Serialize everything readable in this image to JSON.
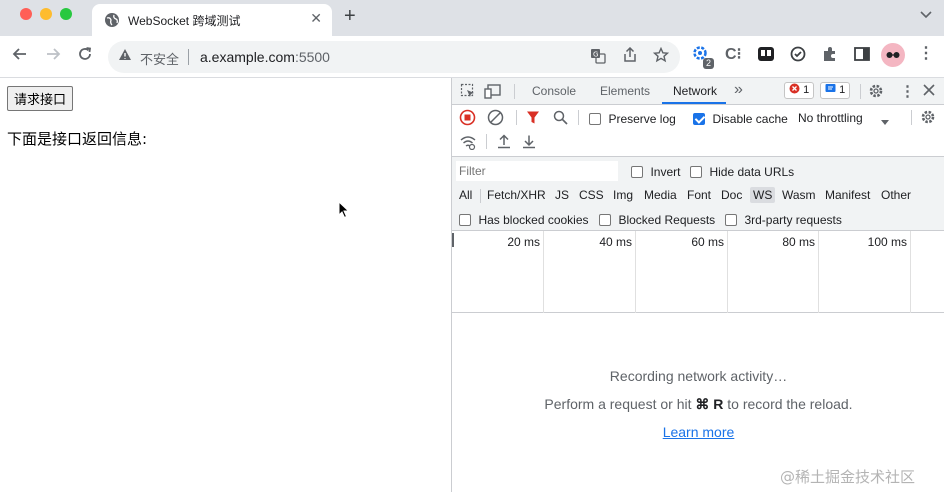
{
  "browser": {
    "tab_title": "WebSocket 跨域测试",
    "url_security": "不安全",
    "url_host": "a.example.com",
    "url_port": ":5500",
    "new_tab_glyph": "+",
    "close_glyph": "✕"
  },
  "page": {
    "request_button": "请求接口",
    "response_label": "下面是接口返回信息:"
  },
  "devtools": {
    "tabs": [
      "Console",
      "Elements",
      "Network"
    ],
    "active_tab": "Network",
    "more_tabs": "»",
    "errors_count": "1",
    "messages_count": "1",
    "preserve_log": "Preserve log",
    "disable_cache": "Disable cache",
    "throttling": "No throttling",
    "filter_placeholder": "Filter",
    "invert": "Invert",
    "hide_data_urls": "Hide data URLs",
    "types": [
      "All",
      "Fetch/XHR",
      "JS",
      "CSS",
      "Img",
      "Media",
      "Font",
      "Doc",
      "WS",
      "Wasm",
      "Manifest",
      "Other"
    ],
    "selected_type": "WS",
    "has_blocked_cookies": "Has blocked cookies",
    "blocked_requests": "Blocked Requests",
    "third_party": "3rd-party requests",
    "timeline_ticks": [
      "20 ms",
      "40 ms",
      "60 ms",
      "80 ms",
      "100 ms"
    ],
    "recording": "Recording network activity…",
    "perform_pre": "Perform a request or hit ",
    "perform_key": "⌘ R",
    "perform_post": " to record the reload.",
    "learn_more": "Learn more"
  },
  "extensions": {
    "badge_count": "2"
  },
  "watermark": "@稀土掘金技术社区",
  "colors": {
    "accent": "#1a73e8",
    "error": "#d93025",
    "record": "#d93025"
  }
}
